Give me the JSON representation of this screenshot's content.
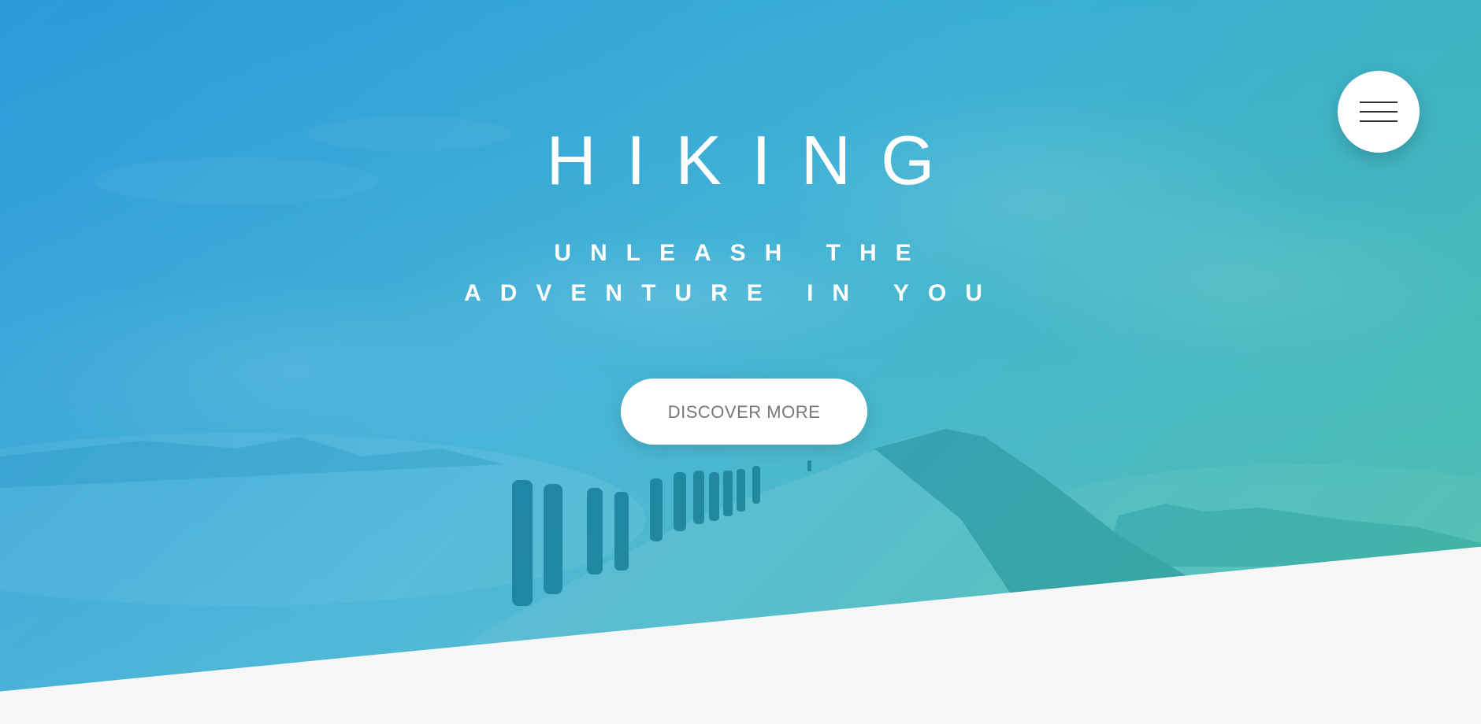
{
  "hero": {
    "title": "HIKING",
    "subtitle": "UNLEASH THE ADVENTURE IN YOU",
    "cta_label": "DISCOVER MORE"
  },
  "navigation": {
    "menu_icon": "hamburger-menu-icon"
  },
  "colors": {
    "gradient_start": "#1890d6",
    "gradient_end": "#2db598",
    "section_background": "#f7f7f7",
    "button_text": "#777777"
  }
}
